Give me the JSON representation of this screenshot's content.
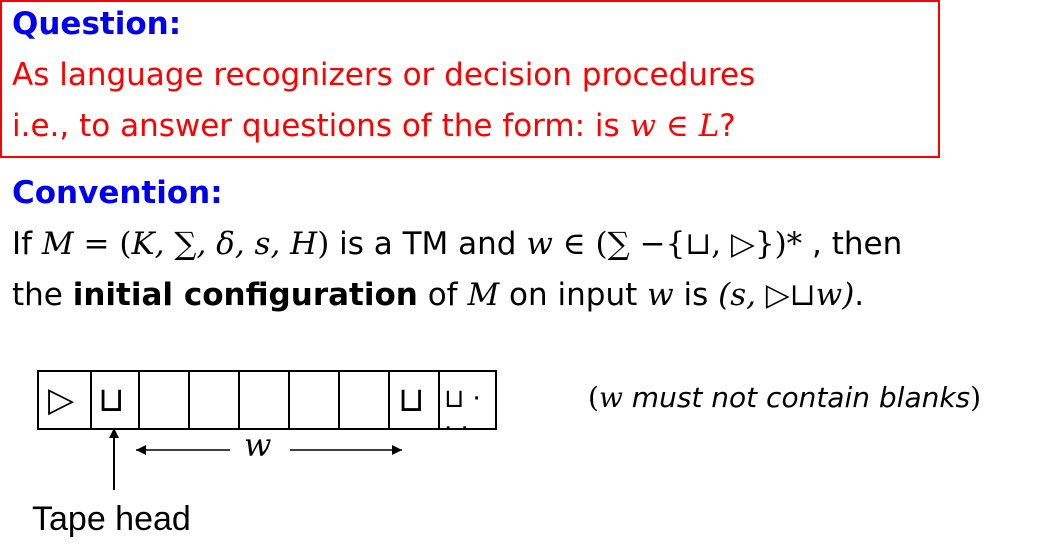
{
  "question": {
    "heading": "Question:",
    "line1": "As language recognizers or decision procedures",
    "line2_prefix": "i.e., to answer questions of the form: is ",
    "line2_math_w": "w",
    "line2_math_in": " ∈ ",
    "line2_math_L": "L",
    "line2_suffix": "?"
  },
  "convention": {
    "heading": "Convention:",
    "line1_prefix": "If ",
    "line1_math_M": "M",
    "line1_math_eq": " = (",
    "line1_math_tuple": "K, ∑, δ, s, H",
    "line1_math_close": ")",
    "line1_mid": " is a TM and ",
    "line1_math_w": "w",
    "line1_math_set": " ∈ (∑ −{⊔, ▷})*",
    "line1_suffix": " , then",
    "line2_prefix": "the ",
    "line2_bold": "initial configuration",
    "line2_mid1": " of ",
    "line2_math_M": "M",
    "line2_mid2": " on input ",
    "line2_math_w": "w",
    "line2_mid3": " is ",
    "line2_config": "(s, ▷⊔w)",
    "line2_end": "."
  },
  "tape": {
    "cells": [
      "▷",
      "⊔",
      "",
      "",
      "",
      "",
      "",
      "⊔",
      "⊔ · · ·"
    ],
    "w_label": "w",
    "head_label": "Tape head"
  },
  "note": {
    "open": "(",
    "w": "w",
    "text": " must not contain blanks",
    "close": ")"
  }
}
